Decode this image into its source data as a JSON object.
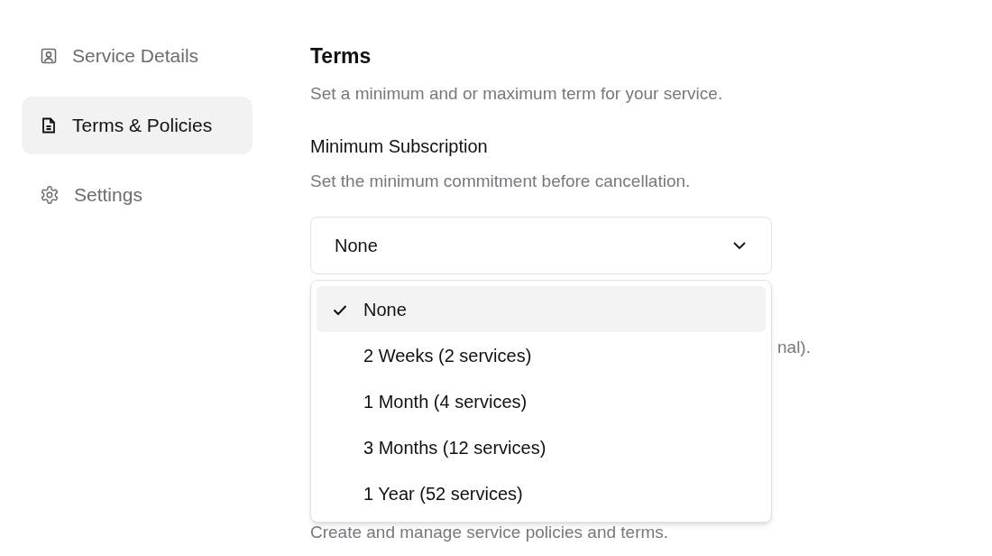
{
  "sidebar": {
    "items": [
      {
        "label": "Service Details",
        "selected": false
      },
      {
        "label": "Terms & Policies",
        "selected": true
      },
      {
        "label": "Settings",
        "selected": false
      }
    ]
  },
  "terms": {
    "title": "Terms",
    "description": "Set a minimum and or maximum term for your service.",
    "minimum_subscription": {
      "label": "Minimum Subscription",
      "description": "Set the minimum commitment before cancellation.",
      "select": {
        "value": "None",
        "expanded": true,
        "options": [
          {
            "label": "None",
            "selected": true
          },
          {
            "label": "2 Weeks (2 services)",
            "selected": false
          },
          {
            "label": "1 Month (4 services)",
            "selected": false
          },
          {
            "label": "3 Months (12 services)",
            "selected": false
          },
          {
            "label": "1 Year (52 services)",
            "selected": false
          }
        ]
      }
    },
    "hidden_description_tail": "nal)."
  },
  "policies": {
    "description": "Create and manage service policies and terms."
  }
}
